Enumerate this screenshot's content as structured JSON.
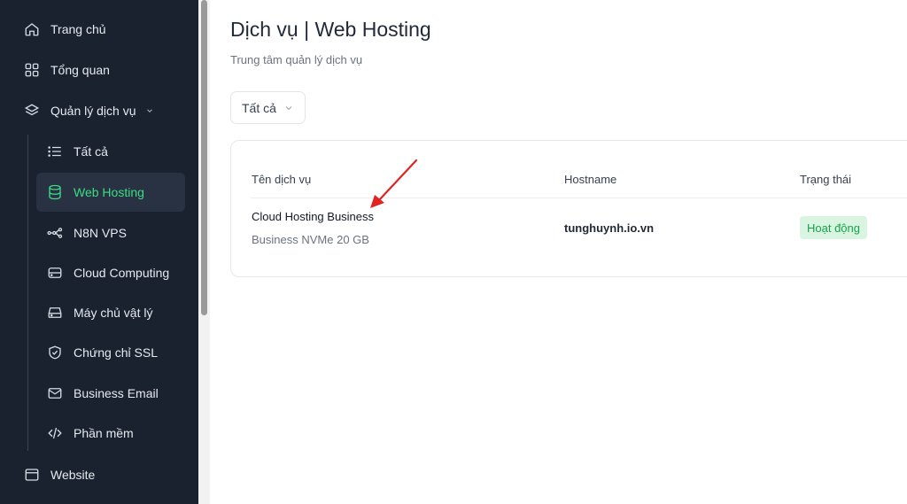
{
  "sidebar": {
    "items": [
      {
        "label": "Trang chủ",
        "icon": "home-icon"
      },
      {
        "label": "Tổng quan",
        "icon": "grid-icon"
      },
      {
        "label": "Quản lý dịch vụ",
        "icon": "layers-icon"
      },
      {
        "label": "Website",
        "icon": "browser-icon"
      }
    ],
    "sub_items": [
      {
        "label": "Tất cả",
        "icon": "list-icon"
      },
      {
        "label": "Web Hosting",
        "icon": "database-icon"
      },
      {
        "label": "N8N VPS",
        "icon": "workflow-icon"
      },
      {
        "label": "Cloud Computing",
        "icon": "server-icon"
      },
      {
        "label": "Máy chủ vật lý",
        "icon": "hard-drive-icon"
      },
      {
        "label": "Chứng chỉ SSL",
        "icon": "shield-check-icon"
      },
      {
        "label": "Business Email",
        "icon": "mail-icon"
      },
      {
        "label": "Phần mềm",
        "icon": "code-icon"
      }
    ]
  },
  "main": {
    "title": "Dịch vụ | Web Hosting",
    "subtitle": "Trung tâm quản lý dịch vụ",
    "filter": {
      "selected": "Tất cả"
    },
    "table": {
      "headers": [
        "Tên dịch vụ",
        "Hostname",
        "Trạng thái"
      ],
      "rows": [
        {
          "name": "Cloud Hosting Business",
          "plan": "Business NVMe 20 GB",
          "hostname": "tunghuynh.io.vn",
          "status": "Hoạt động"
        }
      ]
    }
  },
  "colors": {
    "sidebar_bg": "#1a2230",
    "accent": "#3ddc84",
    "status_bg": "#d9f5e2",
    "status_text": "#17a34a",
    "annotation_arrow": "#e02424"
  }
}
